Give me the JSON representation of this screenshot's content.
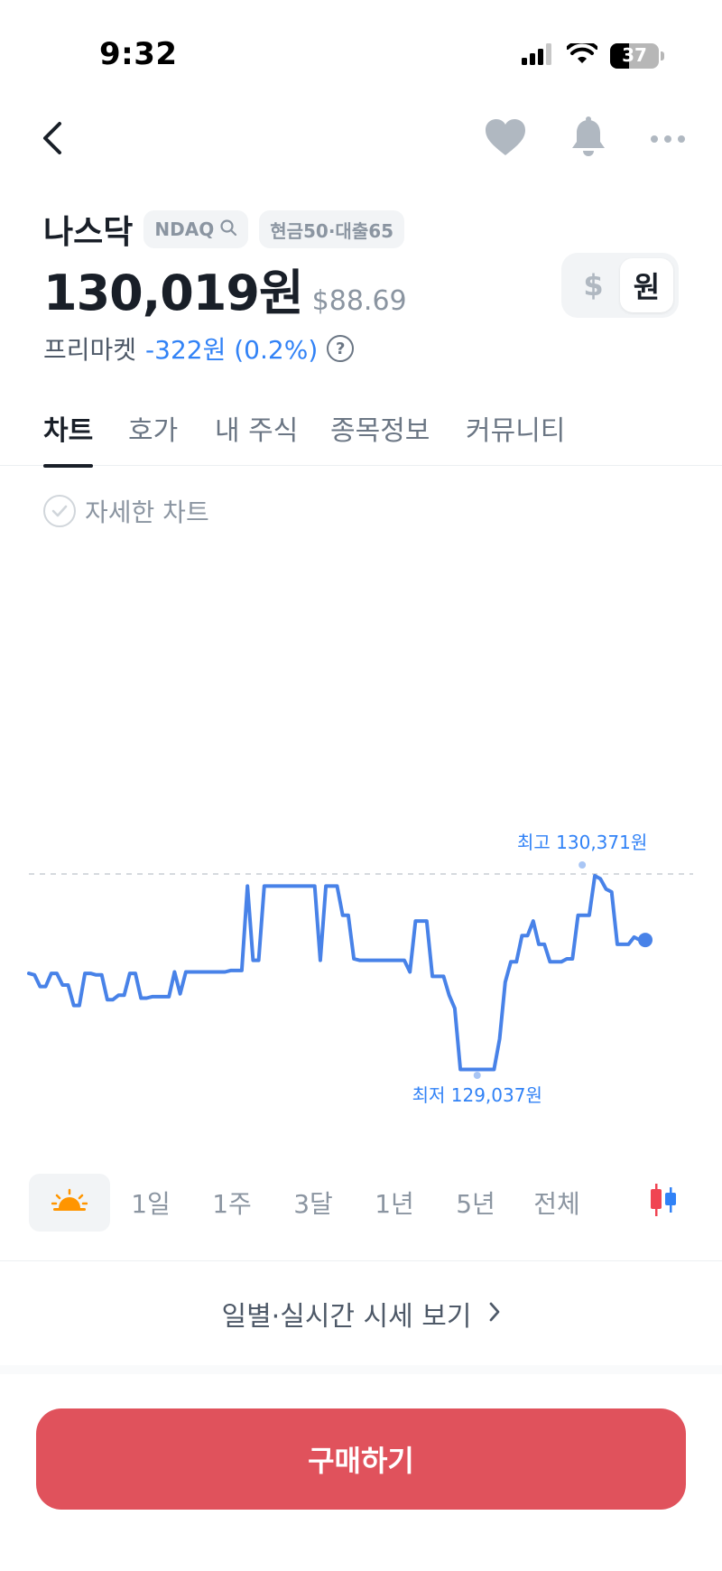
{
  "status": {
    "time": "9:32",
    "battery": "37"
  },
  "stock": {
    "name": "나스닥",
    "ticker_tag": "NDAQ",
    "margin_tag": "현금50·대출65",
    "price_krw": "130,019원",
    "price_usd": "$88.69",
    "premarket_label": "프리마켓",
    "premarket_change": "-322원 (0.2%)",
    "help_glyph": "?"
  },
  "currency_toggle": {
    "usd": "$",
    "krw": "원",
    "selected": "krw"
  },
  "tabs": [
    {
      "label": "차트",
      "active": true
    },
    {
      "label": "호가",
      "active": false
    },
    {
      "label": "내 주식",
      "active": false
    },
    {
      "label": "종목정보",
      "active": false
    },
    {
      "label": "커뮤니티",
      "active": false
    }
  ],
  "detail_chart_label": "자세한 차트",
  "chart_data": {
    "type": "line",
    "high_label": "최고 130,371원",
    "low_label": "최저 129,037원",
    "high": 130371,
    "low": 129037,
    "line_color": "#4882e8",
    "values": [
      129700,
      129690,
      129610,
      129610,
      129700,
      129700,
      129620,
      129620,
      129480,
      129480,
      129700,
      129700,
      129690,
      129690,
      129520,
      129520,
      129550,
      129550,
      129700,
      129700,
      129530,
      129530,
      129540,
      129540,
      129540,
      129540,
      129710,
      129560,
      129710,
      129710,
      129710,
      129710,
      129710,
      129710,
      129710,
      129710,
      129720,
      129720,
      129720,
      130300,
      129790,
      129790,
      130300,
      130300,
      130300,
      130300,
      130300,
      130300,
      130300,
      130300,
      130300,
      130300,
      129790,
      130300,
      130300,
      130300,
      130100,
      130100,
      129800,
      129790,
      129790,
      129790,
      129790,
      129790,
      129790,
      129790,
      129790,
      129790,
      129710,
      130060,
      130060,
      130060,
      129680,
      129680,
      129680,
      129550,
      129460,
      129040,
      129040,
      129040,
      129040,
      129040,
      129040,
      129040,
      129250,
      129640,
      129780,
      129780,
      129960,
      129960,
      130060,
      129900,
      129900,
      129780,
      129780,
      129780,
      129800,
      129800,
      130100,
      130100,
      130100,
      130371,
      130350,
      130280,
      130260,
      129900,
      129900,
      129900,
      129950,
      129930,
      129930
    ],
    "last_value": 129930
  },
  "time_ranges": [
    {
      "label": "sun-icon",
      "active": true
    },
    {
      "label": "1일",
      "active": false
    },
    {
      "label": "1주",
      "active": false
    },
    {
      "label": "3달",
      "active": false
    },
    {
      "label": "1년",
      "active": false
    },
    {
      "label": "5년",
      "active": false
    },
    {
      "label": "전체",
      "active": false
    }
  ],
  "daily_link_label": "일별·실시간 시세 보기",
  "buy_button_label": "구매하기",
  "colors": {
    "accent_blue": "#3182f6",
    "buy_red": "#e0525c",
    "candle_red": "#f04452",
    "candle_blue": "#3182f6",
    "sun_orange": "#ff9500"
  }
}
